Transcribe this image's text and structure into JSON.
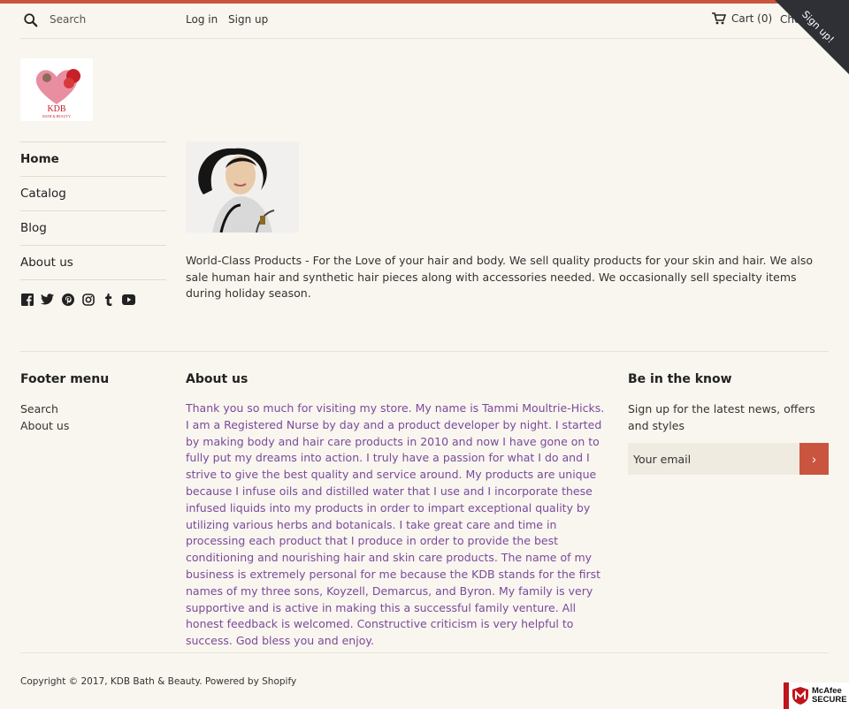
{
  "header": {
    "search_placeholder": "Search",
    "login": "Log in",
    "signup": "Sign up",
    "cart": "Cart (0)",
    "checkout": "Che",
    "ribbon": "Sign up!"
  },
  "logo": {
    "title": "KDB",
    "subtitle": "BATH & BEAUTY"
  },
  "sidebar": {
    "items": [
      {
        "label": "Home"
      },
      {
        "label": "Catalog"
      },
      {
        "label": "Blog"
      },
      {
        "label": "About us"
      }
    ],
    "social": [
      "facebook-icon",
      "twitter-icon",
      "pinterest-icon",
      "instagram-icon",
      "tumblr-icon",
      "youtube-icon"
    ]
  },
  "main": {
    "description": "World-Class Products - For the Love of your hair and body. We sell quality products for your skin and hair. We also sale human hair and synthetic hair pieces along with accessories needed. We occasionally sell specialty items during holiday season."
  },
  "footer": {
    "menu_title": "Footer menu",
    "menu_links": [
      "Search",
      "About us"
    ],
    "about_title": "About us",
    "about_text": "Thank you so much for visiting my store. My name is Tammi Moultrie-Hicks. I am a Registered Nurse by day and a product developer by night. I started by making body and hair care products in 2010 and now I have gone on to fully put my dreams into action. I truly have a passion for what I do and I strive to give the best quality and service around. My products are unique because I infuse oils and distilled water that I use and I incorporate these infused liquids into my products in order to impart exceptional quality by utilizing various herbs and botanicals. I take great care and time in processing each product that I produce in order to provide the best conditioning and nourishing hair and skin care products. The name of my business is extremely personal for me because the KDB stands for the first names of my three sons, Koyzell, Demarcus, and Byron. My family is very supportive and is active in making this a successful family venture.  All honest feedback is welcomed. Constructive criticism is very helpful to success. God bless you and enjoy.",
    "know_title": "Be in the know",
    "know_text": "Sign up for the latest news, offers and styles",
    "email_placeholder": "Your email",
    "submit_glyph": "›",
    "copyright": "Copyright © 2017, KDB Bath & Beauty. Powered by Shopify"
  },
  "badge": {
    "brand": "McAfee",
    "label": "SECURE"
  },
  "colors": {
    "accent": "#c9553f",
    "about_text": "#7a4a9c",
    "background": "#f9f6ef"
  }
}
